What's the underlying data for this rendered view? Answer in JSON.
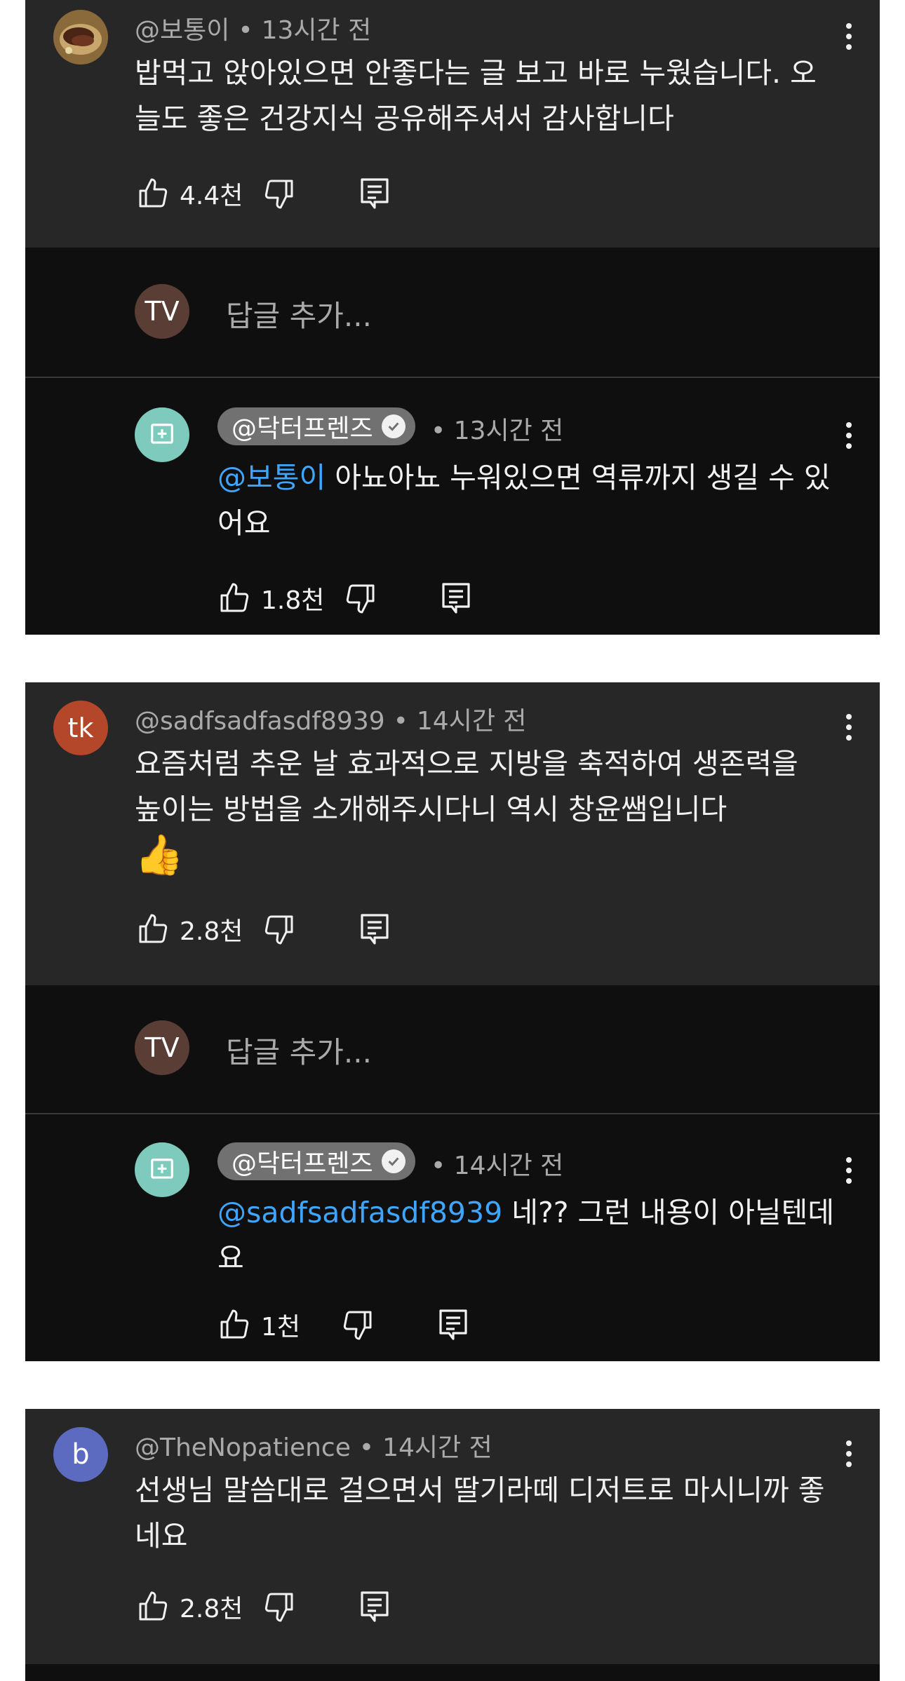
{
  "colors": {
    "card_bg": "#272727",
    "reply_bg": "#0f0f0f",
    "mention": "#3ea6ff",
    "channel_avatar": "#7ecbbd",
    "tv_avatar": "#5a3e36"
  },
  "reply_placeholder": "답글 추가...",
  "my_avatar_initials": "TV",
  "threads": [
    {
      "author": "@보통이",
      "time": "13시간 전",
      "avatar_initials": "",
      "avatar_color": "#6b4a2e",
      "text": "밥먹고 앉아있으면 안좋다는 글 보고 바로 누웠습니다. 오늘도 좋은 건강지식 공유해주셔서 감사합니다",
      "likes": "4.4천",
      "reply": {
        "author": "@닥터프렌즈",
        "time": "13시간 전",
        "mention": "@보통이",
        "text": " 아뇨아뇨 누워있으면 역류까지 생길 수 있어요",
        "likes": "1.8천"
      }
    },
    {
      "author": "@sadfsadfasdf8939",
      "time": "14시간 전",
      "avatar_initials": "tk",
      "avatar_color": "#b4462a",
      "text": "요즘처럼 추운 날 효과적으로 지방을 축적하여 생존력을 높이는 방법을 소개해주시다니 역시 창윤쌤입니다 ",
      "emoji": "👍",
      "likes": "2.8천",
      "reply": {
        "author": "@닥터프렌즈",
        "time": "14시간 전",
        "mention": "@sadfsadfasdf8939",
        "text": " 네?? 그런 내용이 아닐텐데요",
        "likes": "1천"
      }
    },
    {
      "author": "@TheNopatience",
      "time": "14시간 전",
      "avatar_initials": "b",
      "avatar_color": "#5c6bc0",
      "text": "선생님 말씀대로 걸으면서 딸기라떼 디저트로 마시니까 좋네요",
      "likes": "2.8천"
    }
  ]
}
